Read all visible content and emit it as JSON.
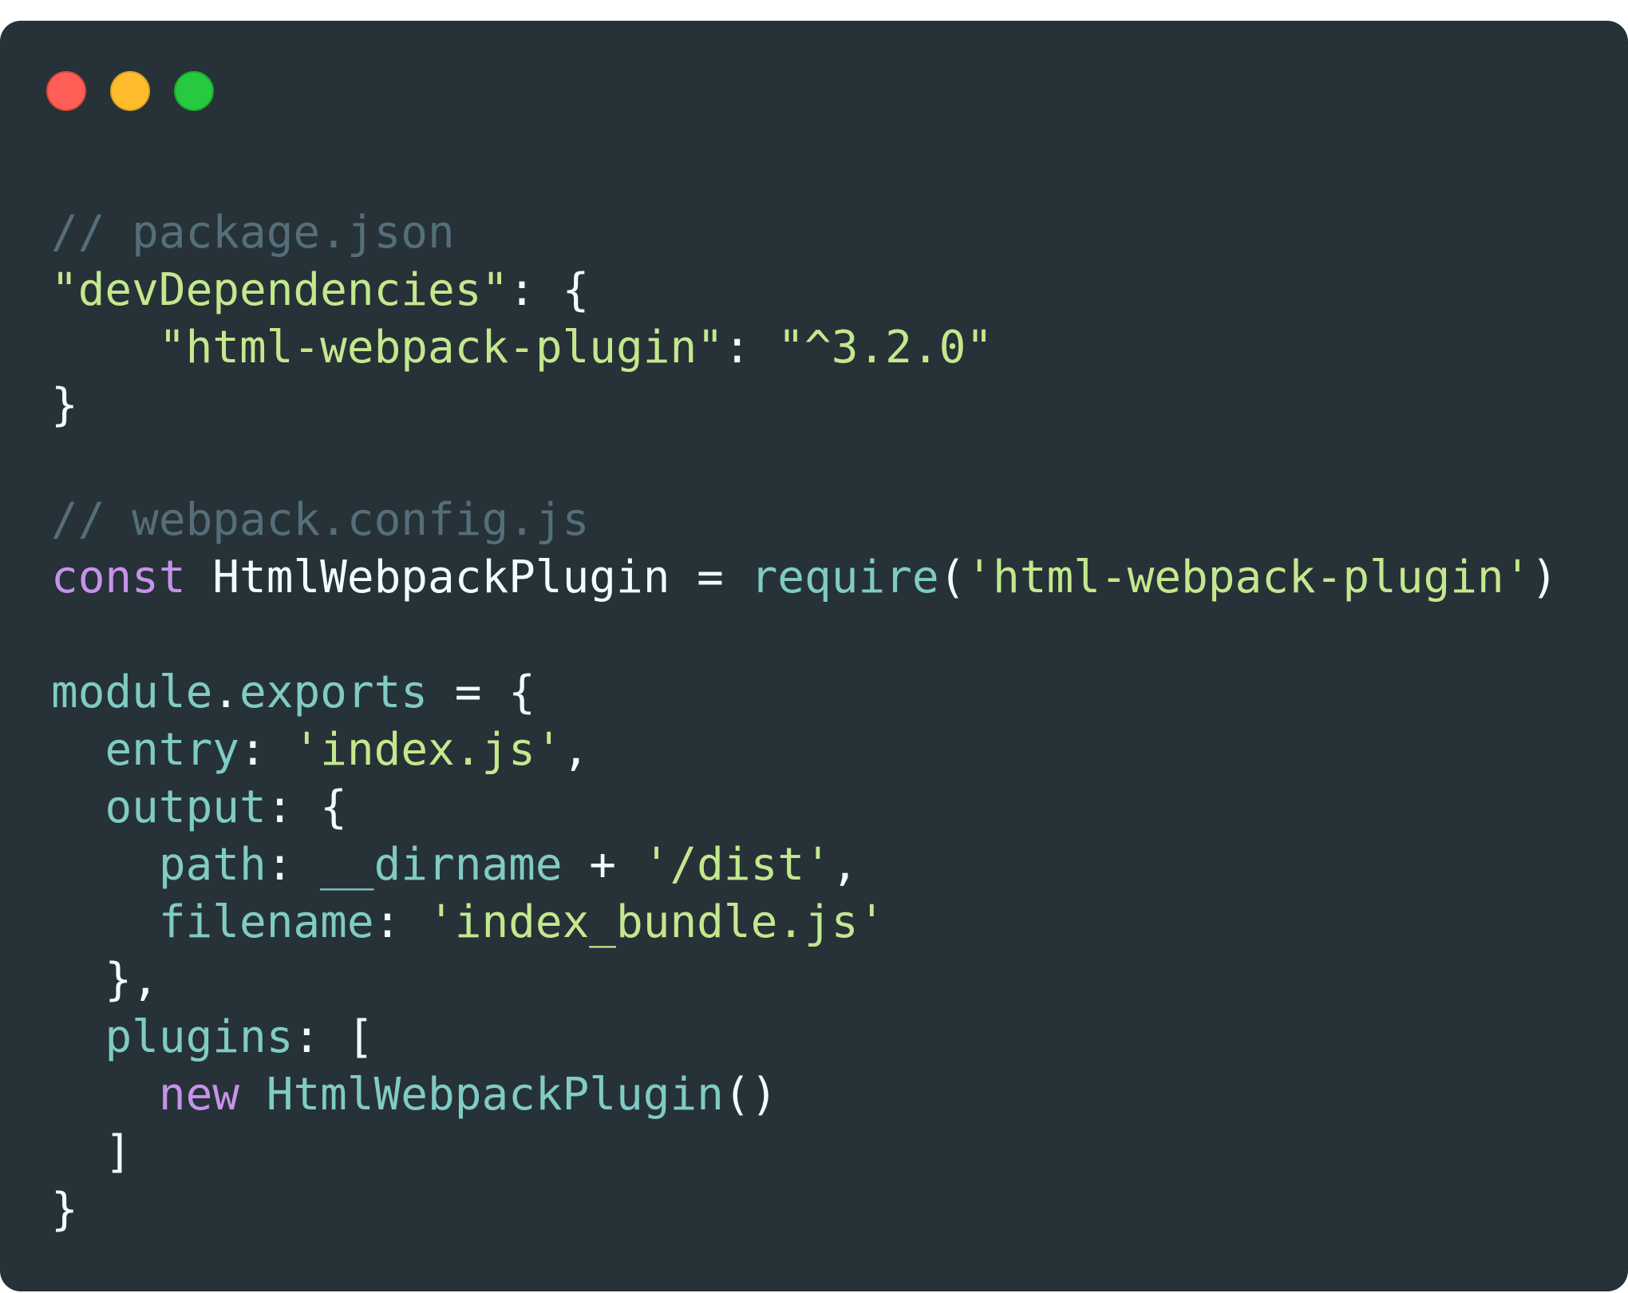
{
  "window": {
    "controls": [
      "close",
      "minimize",
      "maximize"
    ],
    "colors": {
      "background": "#263238",
      "close": "#ff5f56",
      "minimize": "#ffbd2e",
      "maximize": "#27c93f",
      "comment": "#546e7a",
      "string": "#c3e88d",
      "keyword": "#c792ea",
      "function": "#80cbc4",
      "plain": "#eeffff"
    }
  },
  "code": {
    "lines": [
      [
        {
          "t": "comment",
          "v": "// package.json"
        }
      ],
      [
        {
          "t": "str",
          "v": "\"devDependencies\""
        },
        {
          "t": "plain",
          "v": ": {"
        }
      ],
      [
        {
          "t": "plain",
          "v": "    "
        },
        {
          "t": "str",
          "v": "\"html-webpack-plugin\""
        },
        {
          "t": "plain",
          "v": ": "
        },
        {
          "t": "str",
          "v": "\"^3.2.0\""
        }
      ],
      [
        {
          "t": "plain",
          "v": "}"
        }
      ],
      [],
      [
        {
          "t": "comment",
          "v": "// webpack.config.js"
        }
      ],
      [
        {
          "t": "kw",
          "v": "const"
        },
        {
          "t": "plain",
          "v": " HtmlWebpackPlugin = "
        },
        {
          "t": "fn",
          "v": "require"
        },
        {
          "t": "plain",
          "v": "("
        },
        {
          "t": "str",
          "v": "'html-webpack-plugin'"
        },
        {
          "t": "plain",
          "v": ")"
        }
      ],
      [],
      [
        {
          "t": "prop",
          "v": "module"
        },
        {
          "t": "plain",
          "v": "."
        },
        {
          "t": "prop",
          "v": "exports"
        },
        {
          "t": "plain",
          "v": " = {"
        }
      ],
      [
        {
          "t": "plain",
          "v": "  "
        },
        {
          "t": "prop",
          "v": "entry"
        },
        {
          "t": "plain",
          "v": ": "
        },
        {
          "t": "str",
          "v": "'index.js'"
        },
        {
          "t": "plain",
          "v": ","
        }
      ],
      [
        {
          "t": "plain",
          "v": "  "
        },
        {
          "t": "prop",
          "v": "output"
        },
        {
          "t": "plain",
          "v": ": {"
        }
      ],
      [
        {
          "t": "plain",
          "v": "    "
        },
        {
          "t": "prop",
          "v": "path"
        },
        {
          "t": "plain",
          "v": ": "
        },
        {
          "t": "prop",
          "v": "__dirname"
        },
        {
          "t": "plain",
          "v": " + "
        },
        {
          "t": "str",
          "v": "'/dist'"
        },
        {
          "t": "plain",
          "v": ","
        }
      ],
      [
        {
          "t": "plain",
          "v": "    "
        },
        {
          "t": "prop",
          "v": "filename"
        },
        {
          "t": "plain",
          "v": ": "
        },
        {
          "t": "str",
          "v": "'index_bundle.js'"
        }
      ],
      [
        {
          "t": "plain",
          "v": "  },"
        }
      ],
      [
        {
          "t": "plain",
          "v": "  "
        },
        {
          "t": "prop",
          "v": "plugins"
        },
        {
          "t": "plain",
          "v": ": ["
        }
      ],
      [
        {
          "t": "plain",
          "v": "    "
        },
        {
          "t": "kw",
          "v": "new"
        },
        {
          "t": "plain",
          "v": " "
        },
        {
          "t": "fn",
          "v": "HtmlWebpackPlugin"
        },
        {
          "t": "plain",
          "v": "()"
        }
      ],
      [
        {
          "t": "plain",
          "v": "  ]"
        }
      ],
      [
        {
          "t": "plain",
          "v": "}"
        }
      ]
    ]
  }
}
